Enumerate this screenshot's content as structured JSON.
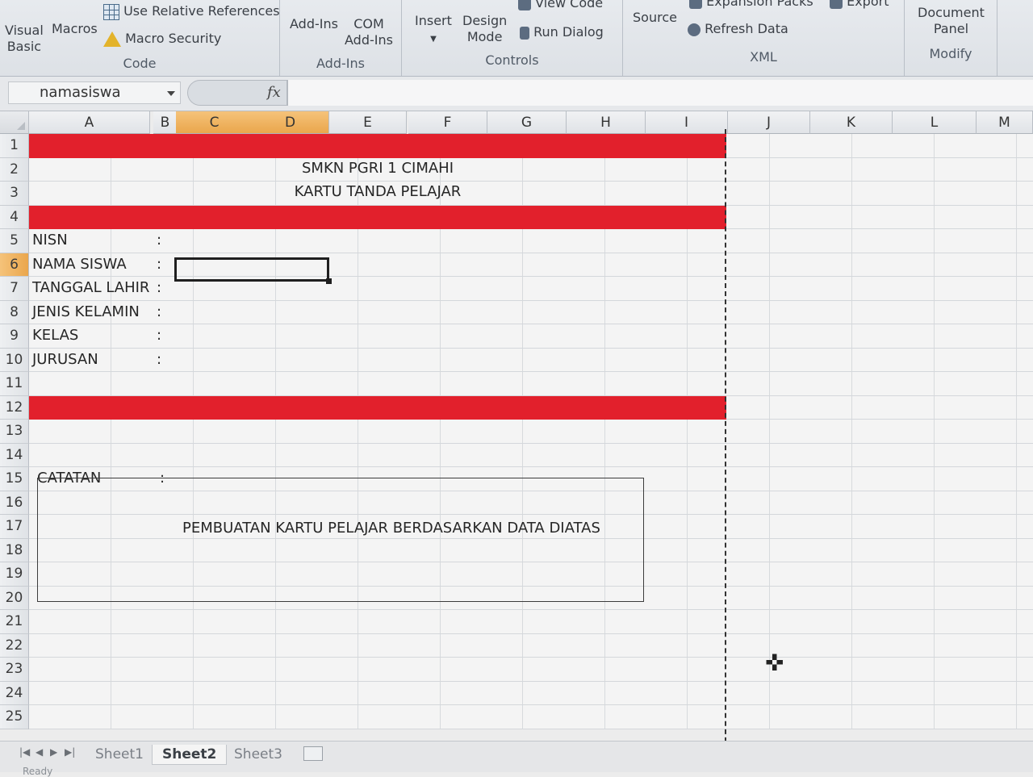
{
  "ribbon": {
    "code": {
      "visual_basic_1": "Visual",
      "visual_basic_2": "Basic",
      "macros": "Macros",
      "use_relative_references": "Use Relative References",
      "macro_security": "Macro Security",
      "group_label": "Code"
    },
    "addins": {
      "addins": "Add-Ins",
      "com_1": "COM",
      "com_2": "Add-Ins",
      "group_label": "Add-Ins"
    },
    "controls": {
      "insert": "Insert",
      "design_1": "Design",
      "design_2": "Mode",
      "view_code": "View Code",
      "run_dialog": "Run Dialog",
      "group_label": "Controls"
    },
    "xml": {
      "source": "Source",
      "expansion_packs": "Expansion Packs",
      "export": "Export",
      "refresh_data": "Refresh Data",
      "group_label": "XML"
    },
    "modify": {
      "document_1": "Document",
      "document_2": "Panel",
      "group_label": "Modify"
    }
  },
  "formula_bar": {
    "name_box": "namasiswa",
    "fx": "fx",
    "value": ""
  },
  "columns": [
    "A",
    "B",
    "C",
    "D",
    "E",
    "F",
    "G",
    "H",
    "I",
    "J",
    "K",
    "L",
    "M"
  ],
  "selected_columns": [
    "C",
    "D"
  ],
  "rows": [
    "1",
    "2",
    "3",
    "4",
    "5",
    "6",
    "7",
    "8",
    "9",
    "10",
    "11",
    "12",
    "13",
    "14",
    "15",
    "16",
    "17",
    "18",
    "19",
    "20",
    "21",
    "22",
    "23",
    "24",
    "25"
  ],
  "selected_row": "6",
  "sheet": {
    "school": "SMKN PGRI 1 CIMAHI",
    "card_title": "KARTU TANDA PELAJAR",
    "fields": [
      {
        "label": "NISN",
        "colon": ":"
      },
      {
        "label": "NAMA SISWA",
        "colon": ":"
      },
      {
        "label": "TANGGAL LAHIR",
        "colon": ":"
      },
      {
        "label": "JENIS KELAMIN",
        "colon": ":"
      },
      {
        "label": "KELAS",
        "colon": ":"
      },
      {
        "label": "JURUSAN",
        "colon": ":"
      }
    ],
    "note_label": "CATATAN",
    "note_colon": ":",
    "note_text": "PEMBUATAN KARTU PELAJAR BERDASARKAN DATA DIATAS",
    "band_color": "#e2202c"
  },
  "tabs": {
    "nav": [
      "|◀",
      "◀",
      "▶",
      "▶|"
    ],
    "sheets": [
      "Sheet1",
      "Sheet2",
      "Sheet3"
    ],
    "active": "Sheet2"
  },
  "status": "Ready"
}
